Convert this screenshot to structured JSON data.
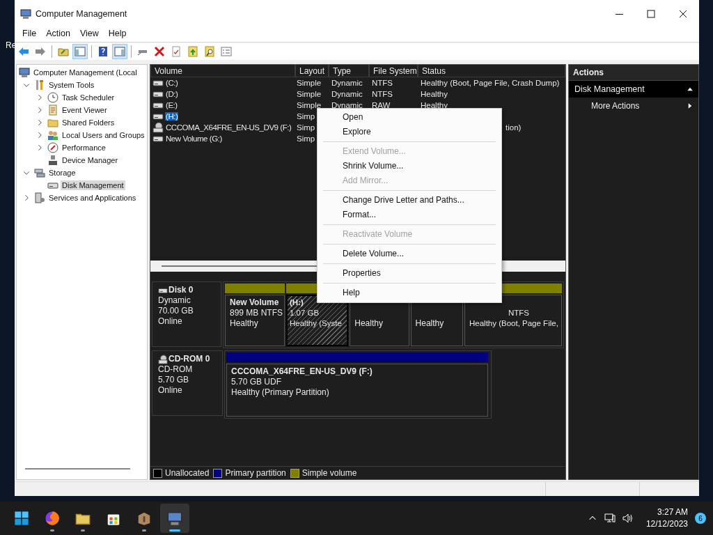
{
  "desktop": {
    "label": "Re"
  },
  "window": {
    "title": "Computer Management"
  },
  "menu": [
    "File",
    "Action",
    "View",
    "Help"
  ],
  "toolbar": [
    {
      "pressed": false
    },
    {
      "pressed": false
    },
    {
      "pressed": false
    },
    {
      "pressed": true
    },
    {
      "pressed": false
    },
    {
      "pressed": true
    },
    {
      "pressed": false
    },
    {
      "pressed": false
    },
    {
      "pressed": false
    },
    {
      "pressed": false
    },
    {
      "pressed": false
    },
    {
      "pressed": false
    }
  ],
  "tree": [
    {
      "label": "Computer Management (Local",
      "selected": false,
      "children": [
        {
          "label": "System Tools",
          "selected": false,
          "expanded": true,
          "children": [
            {
              "label": "Task Scheduler",
              "selected": false,
              "expanded": false
            },
            {
              "label": "Event Viewer",
              "selected": false,
              "expanded": false
            },
            {
              "label": "Shared Folders",
              "selected": false,
              "expanded": false
            },
            {
              "label": "Local Users and Groups",
              "selected": false,
              "expanded": false
            },
            {
              "label": "Performance",
              "selected": false,
              "expanded": false
            },
            {
              "label": "Device Manager",
              "selected": false
            }
          ]
        },
        {
          "label": "Storage",
          "selected": false,
          "expanded": true,
          "children": [
            {
              "label": "Disk Management",
              "selected": true
            }
          ]
        },
        {
          "label": "Services and Applications",
          "selected": false,
          "expanded": false
        }
      ]
    }
  ],
  "volumes": {
    "columns": [
      "Volume",
      "Layout",
      "Type",
      "File System",
      "Status"
    ],
    "rows": [
      {
        "kind": "disk",
        "volume": "(C:)",
        "selected": false,
        "layout": "Simple",
        "type": "Dynamic",
        "file_system": "NTFS",
        "status": "Healthy (Boot, Page File, Crash Dump)"
      },
      {
        "kind": "disk",
        "volume": "(D:)",
        "selected": false,
        "layout": "Simple",
        "type": "Dynamic",
        "file_system": "NTFS",
        "status": "Healthy"
      },
      {
        "kind": "disk",
        "volume": "(E:)",
        "selected": false,
        "layout": "Simple",
        "type": "Dynamic",
        "file_system": "RAW",
        "status": "Healthy"
      },
      {
        "kind": "disk",
        "volume": "(H:)",
        "selected": true,
        "layout": "Simp"
      },
      {
        "kind": "cdrom",
        "volume": "CCCOMA_X64FRE_EN-US_DV9 (F:)",
        "selected": false,
        "layout": "Simp",
        "status": "tion)"
      },
      {
        "kind": "disk",
        "volume": "New Volume (G:)",
        "selected": false,
        "layout": "Simp"
      }
    ]
  },
  "disks": [
    {
      "kind": "disk",
      "name": "Disk 0",
      "lines": [
        "Dynamic",
        "70.00 GB",
        "Online"
      ],
      "partitions": [
        {
          "title": "New Volume",
          "size": "899 MB NTFS",
          "status": "Healthy",
          "selected": false,
          "color": "#808000"
        },
        {
          "title": "(H:)",
          "size": "1.07 GB",
          "status": "Healthy (Syste",
          "selected": true,
          "color": "#808000"
        },
        {
          "status": "Healthy",
          "selected": false
        },
        {
          "status": "Healthy",
          "selected": false
        },
        {
          "size": "NTFS",
          "status": "Healthy (Boot, Page File,",
          "selected": false,
          "color": "#808000"
        }
      ]
    },
    {
      "kind": "cdrom",
      "name": "CD-ROM 0",
      "lines": [
        "CD-ROM",
        "5.70 GB",
        "Online"
      ],
      "partitions": [
        {
          "title": "CCCOMA_X64FRE_EN-US_DV9  (F:)",
          "size": "5.70 GB UDF",
          "status": "Healthy (Primary Partition)",
          "selected": false,
          "color": "#000080"
        }
      ]
    }
  ],
  "legend": [
    {
      "label": "Unallocated",
      "color": "#000000"
    },
    {
      "label": "Primary partition",
      "color": "#000080"
    },
    {
      "label": "Simple volume",
      "color": "#808000"
    }
  ],
  "actions": {
    "title": "Actions",
    "section": "Disk Management",
    "items": [
      "More Actions"
    ]
  },
  "context_menu": [
    {
      "kind": "item",
      "label": "Open",
      "disabled": false
    },
    {
      "kind": "item",
      "label": "Explore",
      "disabled": false
    },
    {
      "kind": "separator"
    },
    {
      "kind": "item",
      "label": "Extend Volume...",
      "disabled": true
    },
    {
      "kind": "item",
      "label": "Shrink Volume...",
      "disabled": false
    },
    {
      "kind": "item",
      "label": "Add Mirror...",
      "disabled": true
    },
    {
      "kind": "separator"
    },
    {
      "kind": "item",
      "label": "Change Drive Letter and Paths...",
      "disabled": false
    },
    {
      "kind": "item",
      "label": "Format...",
      "disabled": false
    },
    {
      "kind": "separator"
    },
    {
      "kind": "item",
      "label": "Reactivate Volume",
      "disabled": true
    },
    {
      "kind": "separator"
    },
    {
      "kind": "item",
      "label": "Delete Volume...",
      "disabled": false
    },
    {
      "kind": "separator"
    },
    {
      "kind": "item",
      "label": "Properties",
      "disabled": false
    },
    {
      "kind": "separator"
    },
    {
      "kind": "item",
      "label": "Help",
      "disabled": false
    }
  ],
  "taskbar": {
    "apps": [
      {
        "running": true,
        "selected": false
      },
      {
        "running": true,
        "selected": false
      },
      {
        "running": false,
        "selected": false
      },
      {
        "running": true,
        "selected": false
      },
      {
        "running": true,
        "selected": true
      }
    ],
    "time": "3:27 AM",
    "date": "12/12/2023",
    "notifications": "6"
  }
}
